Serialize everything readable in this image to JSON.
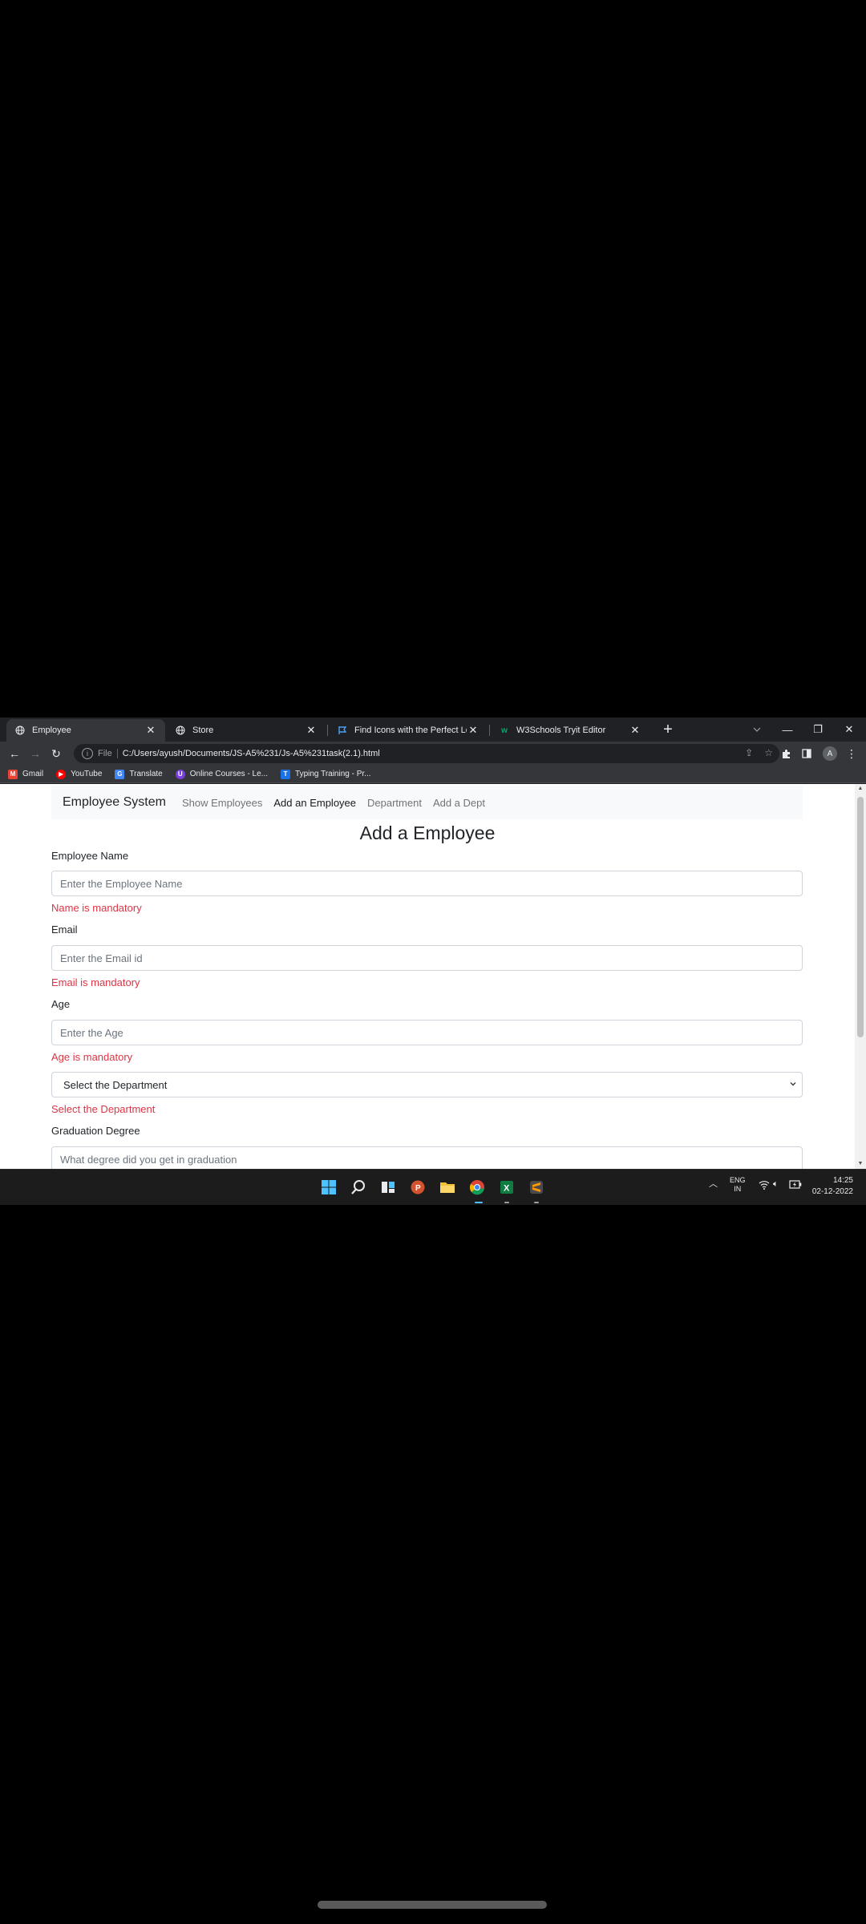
{
  "browser": {
    "tabs": [
      {
        "title": "Employee",
        "active": true,
        "icon": "globe-icon"
      },
      {
        "title": "Store",
        "active": false,
        "icon": "globe-icon"
      },
      {
        "title": "Find Icons with the Perfect Look",
        "active": false,
        "icon": "flag-icon"
      },
      {
        "title": "W3Schools Tryit Editor",
        "active": false,
        "icon": "w3schools-icon"
      }
    ],
    "address": {
      "scheme_label": "File",
      "url": "C:/Users/ayush/Documents/JS-A5%231/Js-A5%231task(2.1).html"
    },
    "profile_initial": "A",
    "bookmarks": [
      {
        "label": "Gmail",
        "icon": "gmail-icon",
        "color": "#ea4335"
      },
      {
        "label": "YouTube",
        "icon": "youtube-icon",
        "color": "#ff0000"
      },
      {
        "label": "Translate",
        "icon": "translate-icon",
        "color": "#4285f4"
      },
      {
        "label": "Online Courses - Le...",
        "icon": "courses-icon",
        "color": "#7b3fe4"
      },
      {
        "label": "Typing Training - Pr...",
        "icon": "typing-icon",
        "color": "#1a73e8"
      }
    ]
  },
  "page": {
    "navbar": {
      "brand": "Employee System",
      "links": [
        {
          "label": "Show Employees",
          "active": false
        },
        {
          "label": "Add an Employee",
          "active": true
        },
        {
          "label": "Department",
          "active": false
        },
        {
          "label": "Add a Dept",
          "active": false
        }
      ]
    },
    "title": "Add a Employee",
    "form": {
      "name": {
        "label": "Employee Name",
        "placeholder": "Enter the Employee Name",
        "error": "Name is mandatory"
      },
      "email": {
        "label": "Email",
        "placeholder": "Enter the Email id",
        "error": "Email is mandatory"
      },
      "age": {
        "label": "Age",
        "placeholder": "Enter the Age",
        "error": "Age is mandatory"
      },
      "department": {
        "selected": "Select the Department",
        "error": "Select the Department"
      },
      "graduation": {
        "label": "Graduation Degree",
        "placeholder": "What degree did you get in graduation"
      }
    }
  },
  "taskbar": {
    "language": {
      "line1": "ENG",
      "line2": "IN"
    },
    "time": "14:25",
    "date": "02-12-2022"
  }
}
